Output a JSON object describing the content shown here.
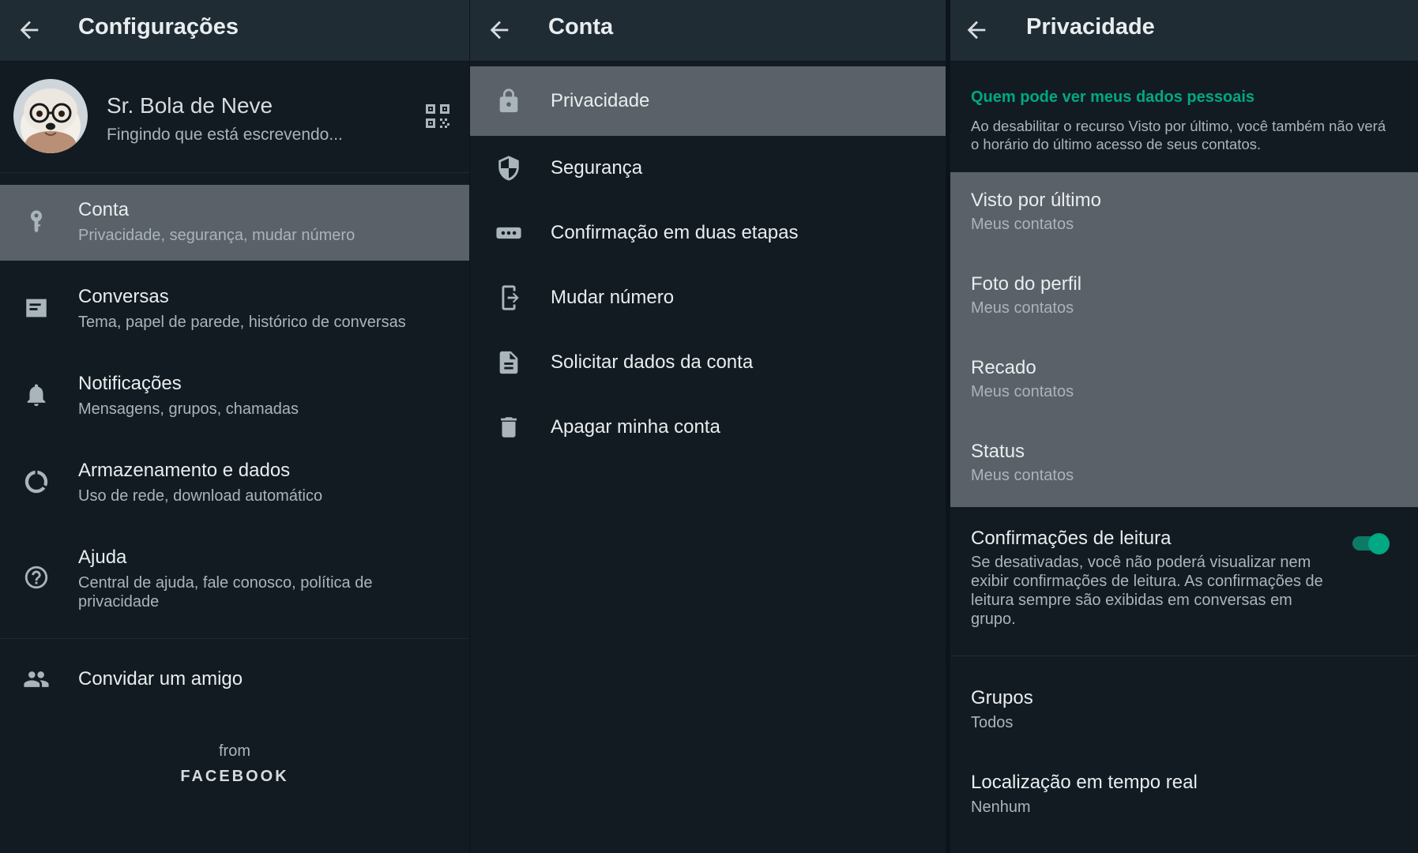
{
  "colors": {
    "accent": "#00a884",
    "appbar": "#1f2c34",
    "background": "#121b22",
    "selected_row": "#5a6168"
  },
  "settings": {
    "title": "Configurações",
    "profile": {
      "name": "Sr. Bola de Neve",
      "status": "Fingindo que está escrevendo..."
    },
    "items": [
      {
        "icon": "key-icon",
        "title": "Conta",
        "subtitle": "Privacidade, segurança, mudar número"
      },
      {
        "icon": "chat-icon",
        "title": "Conversas",
        "subtitle": "Tema, papel de parede, histórico de conversas"
      },
      {
        "icon": "bell-icon",
        "title": "Notificações",
        "subtitle": "Mensagens, grupos, chamadas"
      },
      {
        "icon": "data-usage-icon",
        "title": "Armazenamento e dados",
        "subtitle": "Uso de rede, download automático"
      },
      {
        "icon": "help-icon",
        "title": "Ajuda",
        "subtitle": "Central de ajuda, fale conosco, política de privacidade"
      }
    ],
    "invite": {
      "icon": "people-icon",
      "title": "Convidar um amigo"
    },
    "from_label": "from",
    "brand": "FACEBOOK"
  },
  "account": {
    "title": "Conta",
    "items": [
      {
        "icon": "lock-icon",
        "title": "Privacidade"
      },
      {
        "icon": "shield-icon",
        "title": "Segurança"
      },
      {
        "icon": "dots-icon",
        "title": "Confirmação em duas etapas"
      },
      {
        "icon": "phone-change-icon",
        "title": "Mudar número"
      },
      {
        "icon": "document-icon",
        "title": "Solicitar dados da conta"
      },
      {
        "icon": "trash-icon",
        "title": "Apagar minha conta"
      }
    ]
  },
  "privacy": {
    "title": "Privacidade",
    "section_title": "Quem pode ver meus dados pessoais",
    "section_description": "Ao desabilitar o recurso Visto por último, você também não verá o horário do último acesso de seus contatos.",
    "items": [
      {
        "title": "Visto por último",
        "value": "Meus contatos"
      },
      {
        "title": "Foto do perfil",
        "value": "Meus contatos"
      },
      {
        "title": "Recado",
        "value": "Meus contatos"
      },
      {
        "title": "Status",
        "value": "Meus contatos"
      }
    ],
    "read_receipts": {
      "title": "Confirmações de leitura",
      "description": "Se desativadas, você não poderá visualizar nem exibir confirmações de leitura. As confirmações de leitura sempre são exibidas em conversas em grupo.",
      "enabled": true
    },
    "groups": {
      "title": "Grupos",
      "value": "Todos"
    },
    "live_location": {
      "title": "Localização em tempo real",
      "value": "Nenhum"
    }
  }
}
